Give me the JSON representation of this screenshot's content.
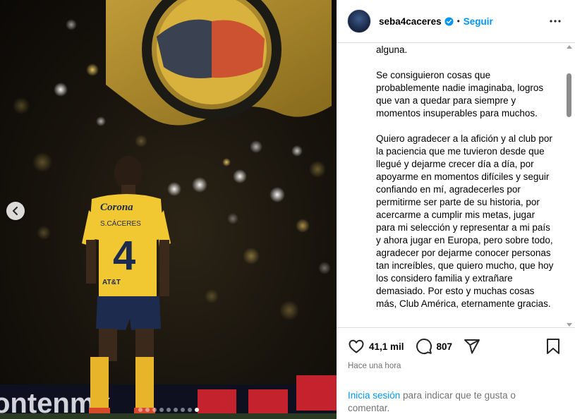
{
  "post": {
    "username": "seba4caceres",
    "follow_label": "Seguir",
    "separator": "•",
    "caption_paragraphs": [
      "lindos que no podido tener, sin duda alguna.",
      "Se consiguieron cosas que probablemente nadie imaginaba, logros que van a quedar para siempre y momentos insuperables para muchos.",
      "Quiero agradecer a la afición y al club por la paciencia que me tuvieron desde que llegué y dejarme crecer día a día, por apoyarme en momentos difíciles y seguir confiando en mí, agradecerles por permitirme ser parte de su historia, por acercarme a cumplir mis metas, jugar para mi selección y representar a mi país y ahora jugar en Europa, pero sobre todo, agradecer por dejarme conocer personas tan increíbles, que quiero mucho, que hoy los considero familia y extrañare demasiado. Por esto y muchas cosas más, Club América, eternamente gracias."
    ],
    "likes": "41,1 mil",
    "comments": "807",
    "timestamp": "Hace una hora",
    "login_link": "Inicia sesión",
    "login_rest": " para indicar que te gusta o comentar."
  },
  "media": {
    "jersey_text": "Corona",
    "jersey_name": "S.CÁCERES",
    "jersey_number": "4",
    "sponsor_sleeve": "AT&T",
    "board_text": "ontenmx",
    "dots_total": 9,
    "dots_active_index": 8
  },
  "colors": {
    "accent": "#0095f6",
    "jersey_yellow": "#f2c832",
    "shorts_navy": "#1d2b4e"
  },
  "icons": [
    "chevron-left-icon",
    "verified-badge-icon",
    "more-options-icon",
    "heart-icon",
    "comment-icon",
    "share-icon",
    "bookmark-icon"
  ]
}
